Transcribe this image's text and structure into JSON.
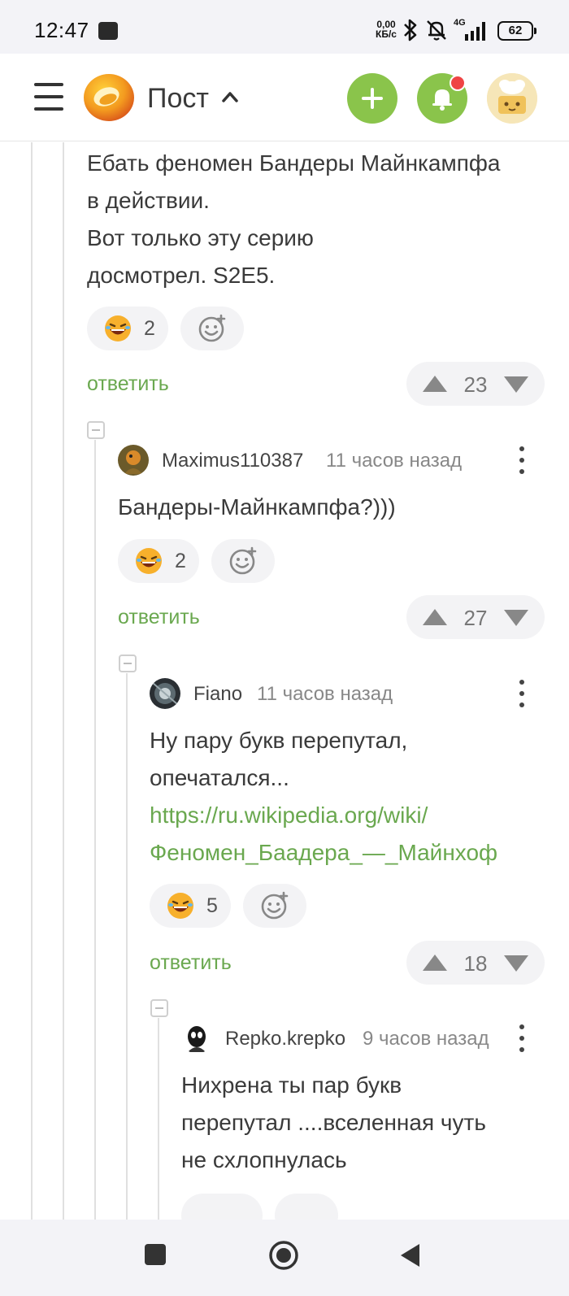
{
  "status_bar": {
    "time": "12:47",
    "speed_value": "0,00",
    "speed_unit": "КБ/с",
    "network": "4G",
    "battery": "62",
    "icons": [
      "app-notification-icon",
      "bluetooth-icon",
      "mute-bell-icon",
      "signal-icon",
      "battery-icon"
    ]
  },
  "header": {
    "title": "Пост",
    "icons": [
      "menu-icon",
      "pikabu-logo-icon",
      "chevron-up-icon",
      "plus-icon",
      "bell-icon",
      "user-avatar"
    ]
  },
  "comments": [
    {
      "text_lines": [
        "Ебать феномен Бандеры Майнкампфа",
        "в действии.",
        "Вот только эту серию",
        "досмотрел. S2E5."
      ],
      "reaction_count": "2",
      "reply_label": "ответить",
      "rating": "23"
    },
    {
      "author": "Maximus110387",
      "time": "11 часов назад",
      "text": "Бандеры-Майнкампфа?)))",
      "reaction_count": "2",
      "reply_label": "ответить",
      "rating": "27"
    },
    {
      "author": "Fiano",
      "time": "11 часов назад",
      "text_lines": [
        "Ну пару букв перепутал,",
        "опечатался..."
      ],
      "link_lines": [
        "https://ru.wikipedia.org/wiki/",
        "Феномен_Баадера_—_Майнхоф"
      ],
      "reaction_count": "5",
      "reply_label": "ответить",
      "rating": "18"
    },
    {
      "author": "Repko.krepko",
      "time": "9 часов назад",
      "text_lines": [
        "Нихрена ты пар букв",
        "перепутал ....вселенная чуть",
        "не схлопнулась"
      ]
    }
  ],
  "colors": {
    "accent_green": "#8ac44b",
    "link_green": "#6aa84f",
    "notification_red": "#ef4444"
  },
  "nav_bar": {
    "icons": [
      "recents-square-icon",
      "home-circle-icon",
      "back-triangle-icon"
    ]
  }
}
